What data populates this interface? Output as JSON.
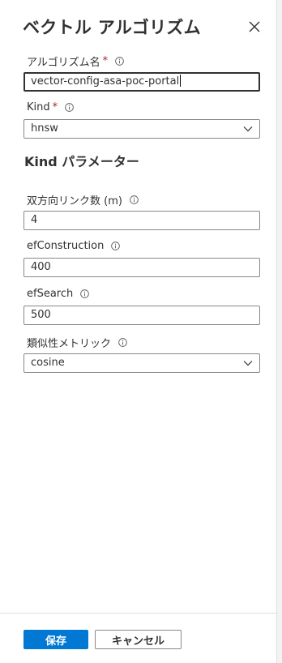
{
  "panel": {
    "title": "ベクトル アルゴリズム",
    "close_icon": "close-icon"
  },
  "form": {
    "algorithm_name": {
      "label": "アルゴリズム名",
      "required": "*",
      "value": "vector-config-asa-poc-portal"
    },
    "kind": {
      "label": "Kind",
      "required": "*",
      "value": "hnsw"
    },
    "params_heading": "Kind パラメーター",
    "m": {
      "label": "双方向リンク数 (m)",
      "value": "4"
    },
    "ef_construction": {
      "label": "efConstruction",
      "value": "400"
    },
    "ef_search": {
      "label": "efSearch",
      "value": "500"
    },
    "metric": {
      "label": "類似性メトリック",
      "value": "cosine"
    }
  },
  "footer": {
    "save_label": "保存",
    "cancel_label": "キャンセル"
  },
  "colors": {
    "primary": "#0078d4",
    "required": "#a4262c",
    "border": "#8a8886",
    "text": "#323130"
  },
  "icons": [
    "close-icon",
    "info-icon",
    "chevron-down-icon"
  ]
}
